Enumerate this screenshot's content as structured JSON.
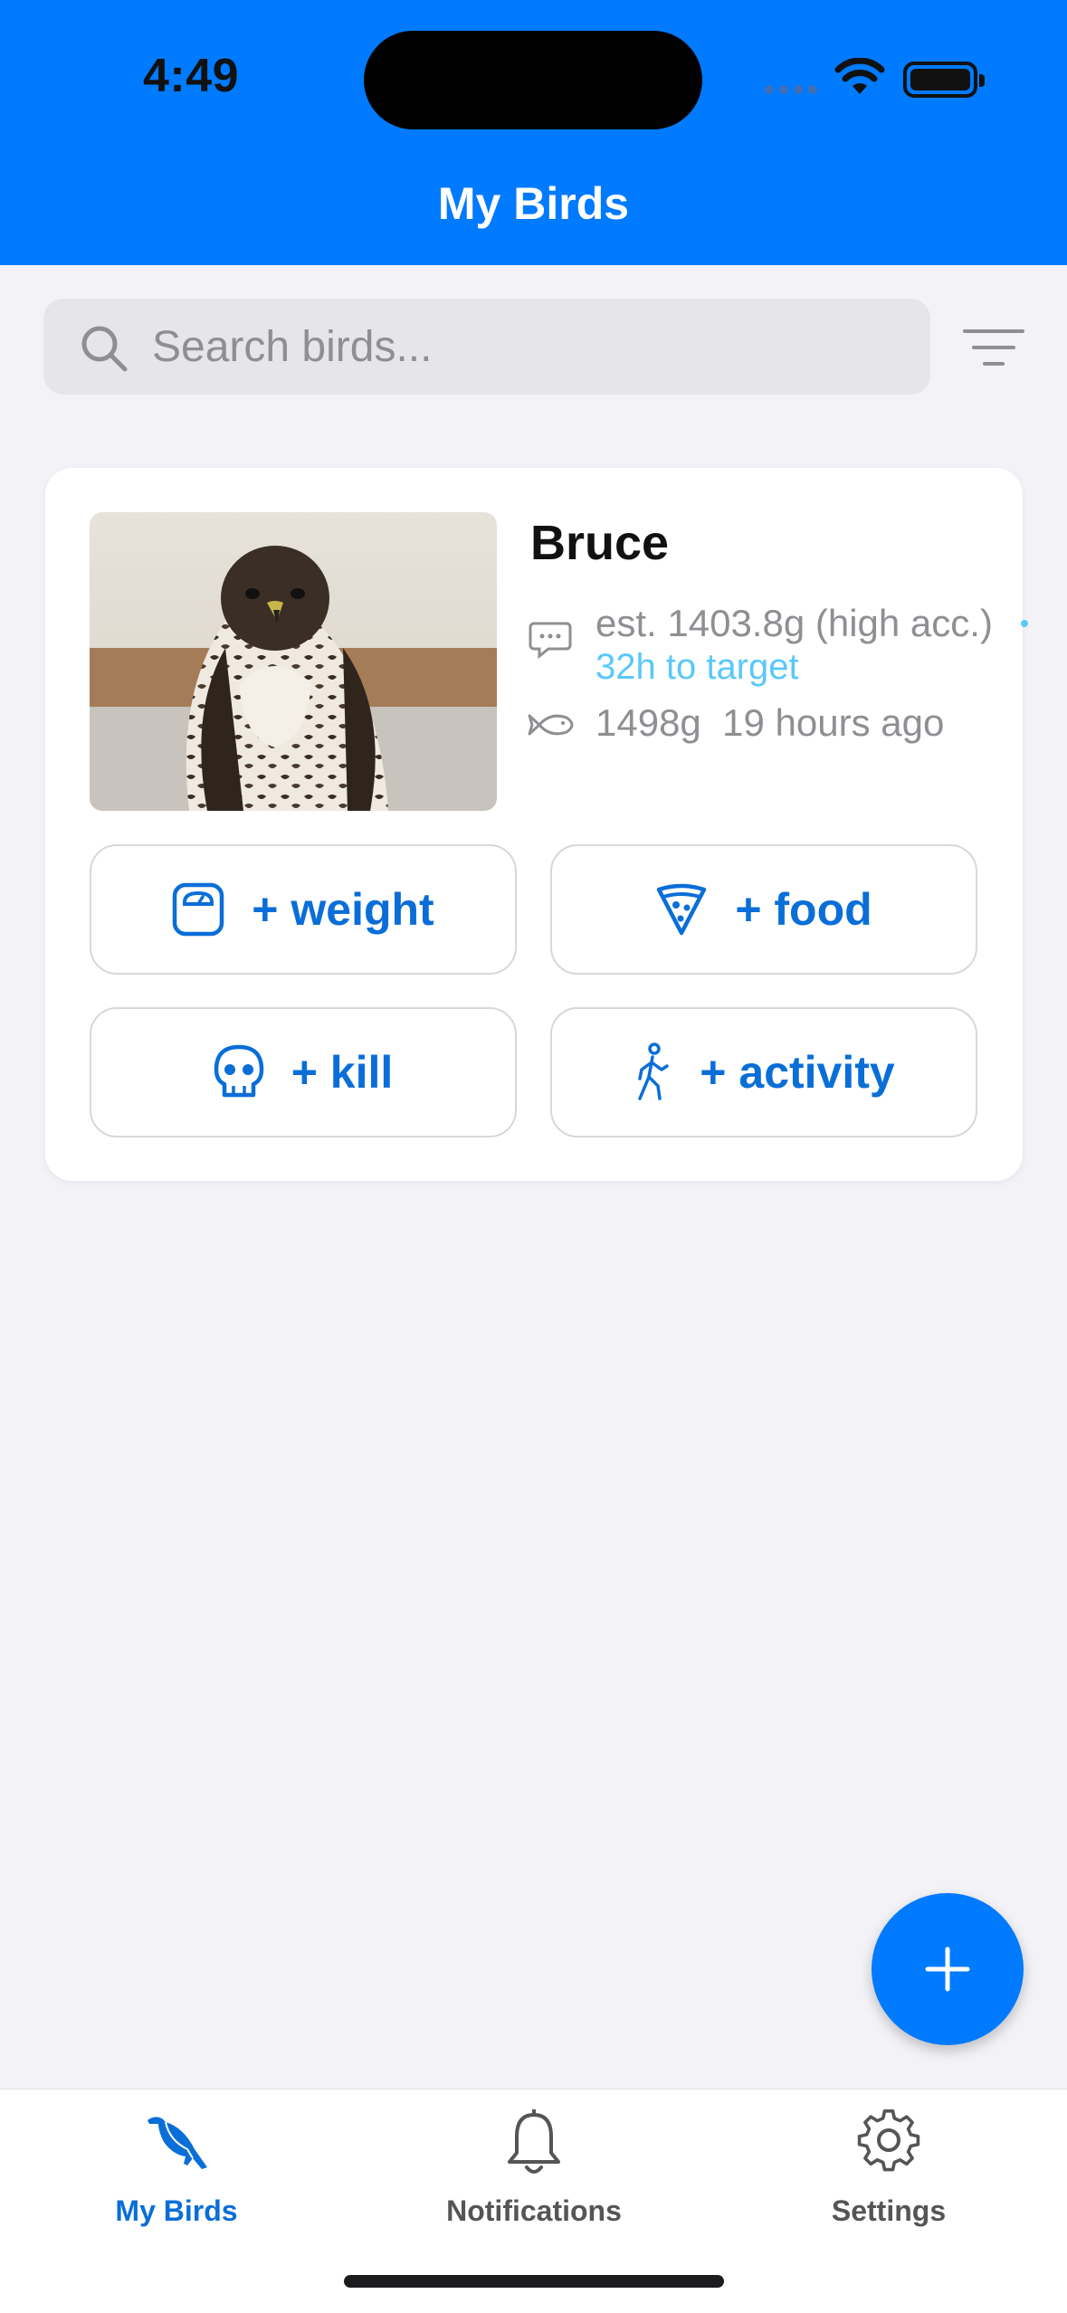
{
  "status_bar": {
    "time": "4:49"
  },
  "header": {
    "title": "My Birds"
  },
  "search": {
    "placeholder": "Search birds..."
  },
  "bird_card": {
    "name": "Bruce",
    "estimate": "est. 1403.8g (high acc.)",
    "to_target": "32h to target",
    "last_weight": "1498g",
    "last_weight_time": "19 hours ago",
    "actions": {
      "weight": "+ weight",
      "food": "+ food",
      "kill": "+ kill",
      "activity": "+ activity"
    }
  },
  "tabs": [
    {
      "label": "My Birds",
      "icon": "bird-icon",
      "active": true
    },
    {
      "label": "Notifications",
      "icon": "bell-icon",
      "active": false
    },
    {
      "label": "Settings",
      "icon": "gear-icon",
      "active": false
    }
  ],
  "colors": {
    "accent": "#007aff",
    "accent_text": "#0a6ed8",
    "secondary_text": "#8e8e93",
    "info": "#5ac8fa",
    "background": "#f2f2f7"
  }
}
